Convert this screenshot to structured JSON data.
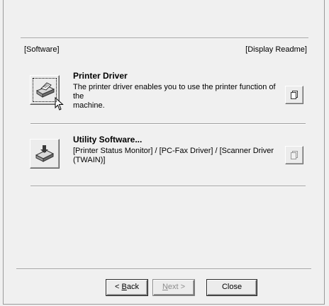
{
  "header": {
    "left": "[Software]",
    "right": "[Display Readme]"
  },
  "items": [
    {
      "title": "Printer Driver",
      "desc_line1": "The printer driver enables you to use the printer function of the",
      "desc_line2": "machine."
    },
    {
      "title": "Utility Software...",
      "desc_line1": "[Printer Status Monitor] / [PC-Fax Driver] / [Scanner Driver",
      "desc_line2": "(TWAIN)]"
    }
  ],
  "buttons": {
    "back_prefix": "< ",
    "back_mnemonic": "B",
    "back_rest": "ack",
    "next_mnemonic": "N",
    "next_rest": "ext >",
    "close": "Close"
  }
}
